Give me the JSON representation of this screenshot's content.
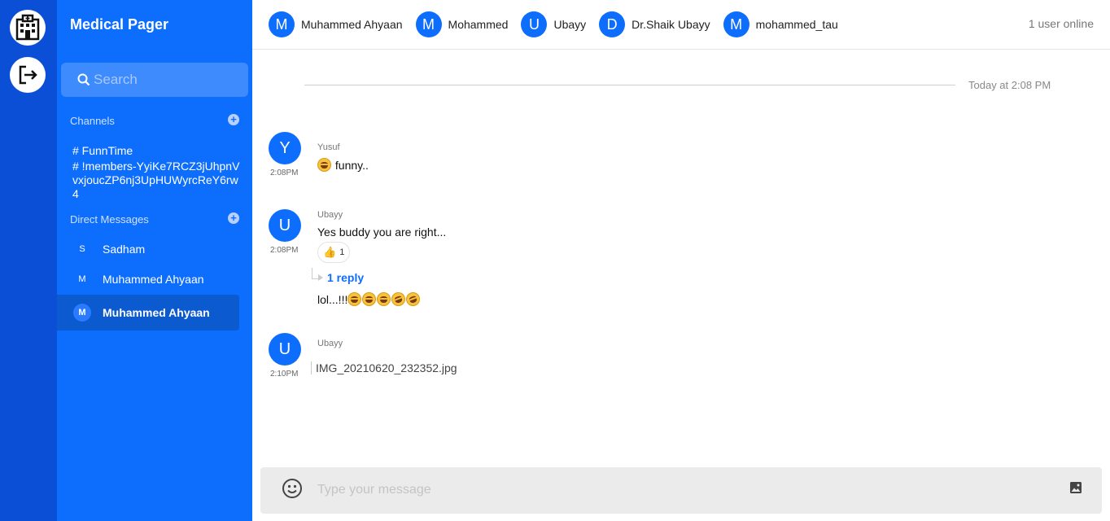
{
  "app": {
    "title": "Medical Pager"
  },
  "sidebar": {
    "search_placeholder": "Search",
    "channels_label": "Channels",
    "channels": [
      {
        "label": "# FunnTime"
      },
      {
        "label": "# !members-YyiKe7RCZ3jUhpnVvxjoucZP6nj3UpHUWyrcReY6rw4"
      }
    ],
    "dm_label": "Direct Messages",
    "dms": [
      {
        "initial": "S",
        "name": "Sadham"
      },
      {
        "initial": "M",
        "name": "Muhammed Ahyaan"
      },
      {
        "initial": "M",
        "name": "Muhammed Ahyaan"
      }
    ]
  },
  "header": {
    "members": [
      {
        "initial": "M",
        "name": "Muhammed Ahyaan"
      },
      {
        "initial": "M",
        "name": "Mohammed"
      },
      {
        "initial": "U",
        "name": "Ubayy"
      },
      {
        "initial": "D",
        "name": "Dr.Shaik Ubayy"
      },
      {
        "initial": "M",
        "name": "mohammed_taufiq"
      }
    ],
    "online_status": "1 user online"
  },
  "chat": {
    "date_label": "Today at 2:08 PM",
    "messages": [
      {
        "initial": "Y",
        "author": "Yusuf",
        "time": "2:08PM",
        "text": "funny.."
      },
      {
        "initial": "U",
        "author": "Ubayy",
        "time": "2:08PM",
        "text": "Yes buddy you are right...",
        "reaction_emoji": "👍",
        "reaction_count": "1",
        "reply_label": "1 reply",
        "reply_text": "lol...!!!"
      },
      {
        "initial": "U",
        "author": "Ubayy",
        "time": "2:10PM",
        "file_name": "IMG_20210620_232352.jpg"
      }
    ]
  },
  "composer": {
    "placeholder": "Type your message"
  },
  "colors": {
    "primary": "#0d6efd",
    "rail": "#0a4fd6"
  },
  "icons": [
    "hospital-icon",
    "logout-icon",
    "search-icon",
    "add-icon",
    "emoji-icon",
    "image-icon"
  ]
}
